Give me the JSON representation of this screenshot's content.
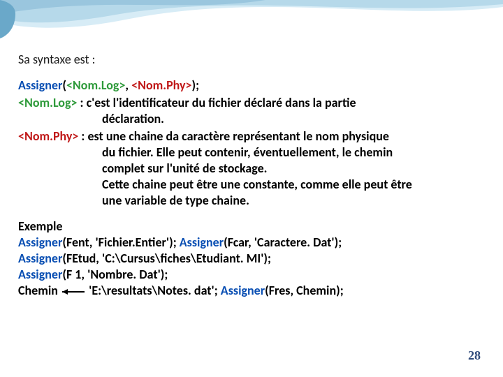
{
  "header": {
    "intro": "Sa syntaxe est :"
  },
  "syntax": {
    "fn": "Assigner",
    "open": "(",
    "arg1": "<Nom.Log>",
    "comma": ", ",
    "arg2": "<Nom.Phy>",
    "close": ");"
  },
  "desc1": {
    "label": "<Nom.Log>",
    "text1": " : c'est l'identificateur du fichier déclaré dans la partie",
    "text2": "déclaration."
  },
  "desc2": {
    "label": "<Nom.Phy>",
    "text1": " : est une chaine da caractère représentant le nom physique",
    "text2": "du fichier. Elle peut contenir, éventuellement, le chemin",
    "text3": "complet sur l'unité de stockage.",
    "text4": "Cette chaine peut être une constante, comme elle peut être",
    "text5": "une variable de type chaine."
  },
  "example": {
    "title": "Exemple",
    "l1a": "Assigner",
    "l1b": "(Fent, 'Fichier.Entier'); ",
    "l1c": "Assigner",
    "l1d": "(Fcar, 'Caractere. Dat');",
    "l2a": "Assigner",
    "l2b": "(FEtud, 'C:\\Cursus\\fiches\\Etudiant. MI');",
    "l3a": "Assigner",
    "l3b": "(F 1, 'Nombre. Dat');",
    "l4a": "Chemin ",
    "l4b": " 'E:\\resultats\\Notes. dat'; ",
    "l4c": "Assigner",
    "l4d": "(Fres, Chemin);"
  },
  "page_number": "28"
}
